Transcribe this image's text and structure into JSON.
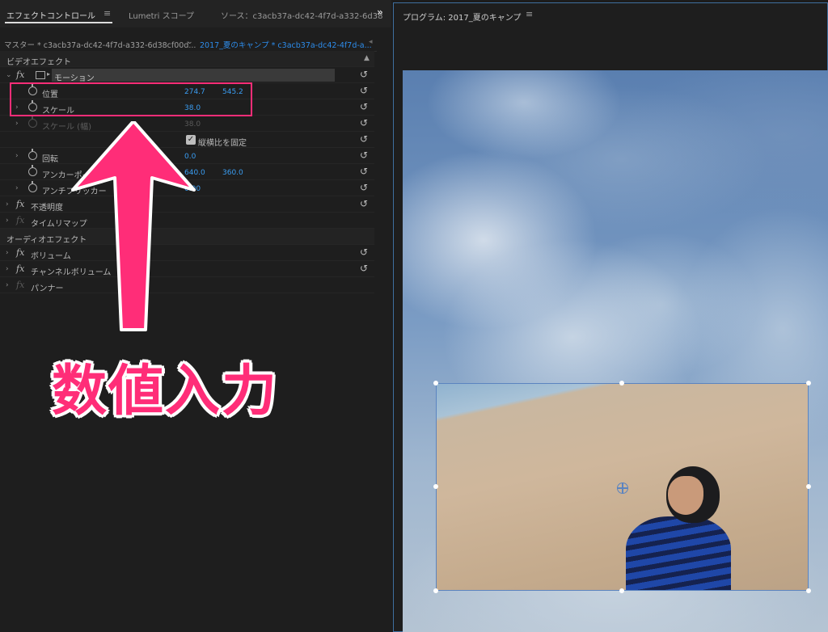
{
  "left_panel": {
    "tabs": {
      "effect_controls": "エフェクトコントロール",
      "effect_controls_menu": "≡",
      "lumetri": "Lumetri スコープ",
      "source": "ソース：c3acb37a-dc42-4f7d-a332-6d38",
      "more": "»"
    },
    "sequence_bar": {
      "master": "マスター * c3acb37a-dc42-4f7d-a332-6d38cf00d...",
      "chevron": "⌄",
      "clip": "2017_夏のキャンプ * c3acb37a-dc42-4f7d-a...",
      "arrow": "◂"
    },
    "sections": {
      "video_effects": "ビデオエフェクト",
      "audio_effects": "オーディオエフェクト"
    },
    "motion": {
      "fx": "fx",
      "label": "モーション",
      "position": {
        "label": "位置",
        "x": "274.7",
        "y": "545.2"
      },
      "scale": {
        "label": "スケール",
        "value": "38.0"
      },
      "scale_width": {
        "label": "スケール (幅)",
        "value": "38.0"
      },
      "uniform_scale": {
        "label": "縦横比を固定",
        "checked": true
      },
      "rotation": {
        "label": "回転",
        "value": "0.0"
      },
      "anchor_point": {
        "label": "アンカーポイント",
        "x": "640.0",
        "y": "360.0"
      },
      "anti_flicker": {
        "label": "アンチフリッカー",
        "value": "0.00"
      }
    },
    "opacity": {
      "fx": "fx",
      "label": "不透明度"
    },
    "time_remap": {
      "fx": "fx",
      "label": "タイムリマップ"
    },
    "volume": {
      "fx": "fx",
      "label": "ボリューム"
    },
    "channel_volume": {
      "fx": "fx",
      "label": "チャンネルボリューム"
    },
    "panner": {
      "fx": "fx",
      "label": "パンナー"
    },
    "icons": {
      "reset": "↺",
      "chevron_right": "›",
      "chevron_down": "⌄",
      "up": "▲",
      "check": "✓",
      "transform_tri": "▸"
    }
  },
  "annotation": {
    "callout_text": "数値入力",
    "accent_color": "#ff2d78"
  },
  "program_monitor": {
    "title": "プログラム: 2017_夏のキャンプ",
    "menu": "≡"
  }
}
